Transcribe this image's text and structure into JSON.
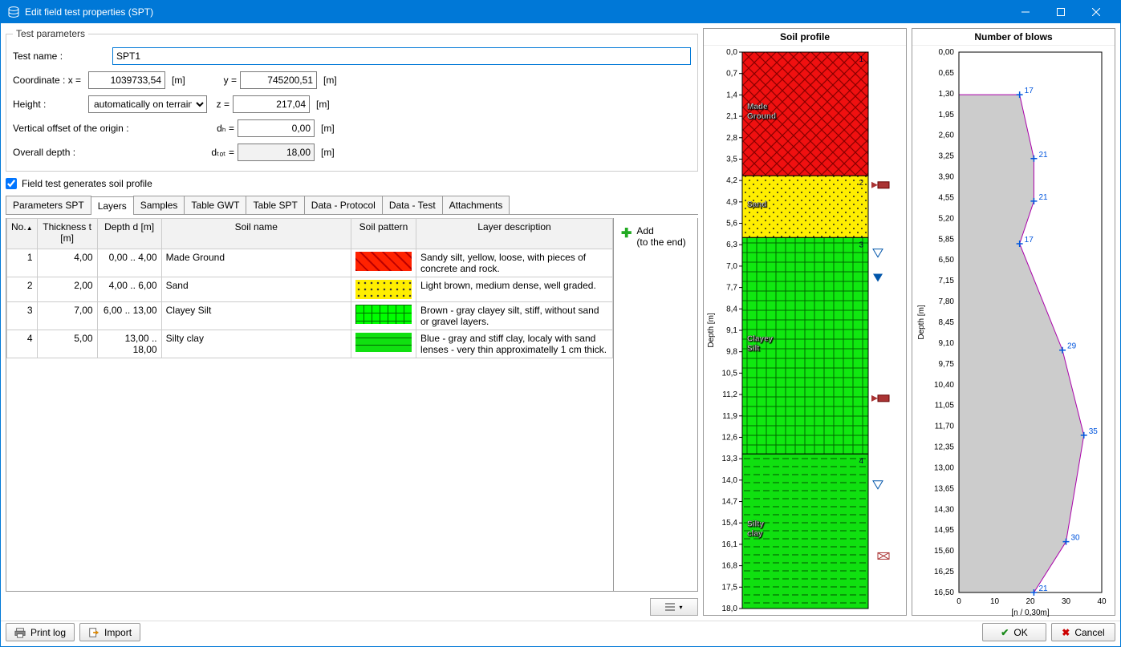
{
  "window": {
    "title": "Edit field test properties (SPT)"
  },
  "params": {
    "legend": "Test parameters",
    "testname_lbl": "Test name :",
    "testname": "SPT1",
    "coord_lbl": "Coordinate : x =",
    "x": "1039733,54",
    "x_unit": "[m]",
    "y_lbl": "y =",
    "y": "745200,51",
    "y_unit": "[m]",
    "height_lbl": "Height :",
    "height_mode": "automatically on terrain",
    "z_lbl": "z =",
    "z": "217,04",
    "z_unit": "[m]",
    "voff_lbl": "Vertical offset of the origin :",
    "dh_lbl": "dₕ =",
    "dh": "0,00",
    "dh_unit": "[m]",
    "depth_lbl": "Overall depth :",
    "dtot_lbl": "dₜₒₜ =",
    "dtot": "18,00",
    "dtot_unit": "[m]",
    "gen_chk": "Field test generates soil profile"
  },
  "tabs": [
    "Parameters SPT",
    "Layers",
    "Samples",
    "Table GWT",
    "Table SPT",
    "Data - Protocol",
    "Data - Test",
    "Attachments"
  ],
  "active_tab": 1,
  "table": {
    "headers": {
      "no": "No.",
      "thick": "Thickness\nt [m]",
      "depth": "Depth\nd [m]",
      "name": "Soil name",
      "patt": "Soil pattern",
      "desc": "Layer description"
    },
    "rows": [
      {
        "no": "1",
        "t": "4,00",
        "d": "0,00 .. 4,00",
        "name": "Made Ground",
        "patt": "red",
        "desc": "Sandy silt, yellow, loose, with pieces of concrete and rock."
      },
      {
        "no": "2",
        "t": "2,00",
        "d": "4,00 .. 6,00",
        "name": "Sand",
        "patt": "yellow",
        "desc": "Light brown, medium dense, well graded."
      },
      {
        "no": "3",
        "t": "7,00",
        "d": "6,00 .. 13,00",
        "name": "Clayey Silt",
        "patt": "green1",
        "desc": "Brown - gray clayey silt, stiff, without sand or gravel layers."
      },
      {
        "no": "4",
        "t": "5,00",
        "d": "13,00 .. 18,00",
        "name": "Silty clay",
        "patt": "green2",
        "desc": "Blue - gray and stiff clay, localy with sand lenses - very thin approximatelly 1 cm thick."
      }
    ],
    "add": "Add",
    "add2": "(to the end)"
  },
  "profile": {
    "title": "Soil profile",
    "ylabel": "Depth [m]",
    "ticks": [
      "0,0",
      "0,7",
      "1,4",
      "2,1",
      "2,8",
      "3,5",
      "4,2",
      "4,9",
      "5,6",
      "6,3",
      "7,0",
      "7,7",
      "8,4",
      "9,1",
      "9,8",
      "10,5",
      "11,2",
      "11,9",
      "12,6",
      "13,3",
      "14,0",
      "14,7",
      "15,4",
      "16,1",
      "16,8",
      "17,5",
      "18,0"
    ],
    "layers": [
      {
        "name": "Made Ground",
        "from": 0,
        "to": 4,
        "num": "1",
        "patt": "red"
      },
      {
        "name": "Sand",
        "from": 4,
        "to": 6,
        "num": "2",
        "patt": "yellow"
      },
      {
        "name": "Clayey Silt",
        "from": 6,
        "to": 13,
        "num": "3",
        "patt": "green1"
      },
      {
        "name": "Silty clay",
        "from": 13,
        "to": 18,
        "num": "4",
        "patt": "green2"
      }
    ]
  },
  "blows": {
    "title": "Number of blows",
    "ylabel": "Depth [m]",
    "xlabel": "[n / 0,30m]",
    "yticks": [
      "0,00",
      "0,65",
      "1,30",
      "1,95",
      "2,60",
      "3,25",
      "3,90",
      "4,55",
      "5,20",
      "5,85",
      "6,50",
      "7,15",
      "7,80",
      "8,45",
      "9,10",
      "9,75",
      "10,40",
      "11,05",
      "11,70",
      "12,35",
      "13,00",
      "13,65",
      "14,30",
      "14,95",
      "15,60",
      "16,25",
      "16,50"
    ],
    "xticks": [
      "0",
      "10",
      "20",
      "30",
      "40"
    ]
  },
  "chart_data": {
    "type": "line",
    "title": "Number of blows",
    "x": [
      17,
      21,
      21,
      17,
      29,
      35,
      30,
      21
    ],
    "y": [
      1.3,
      3.25,
      4.55,
      5.85,
      9.1,
      11.7,
      14.95,
      16.5
    ],
    "xlabel": "[n / 0,30m]",
    "ylabel": "Depth [m]",
    "xlim": [
      0,
      40
    ],
    "ylim": [
      0,
      16.5
    ],
    "y_inverted": true
  },
  "footer": {
    "print": "Print log",
    "import": "Import",
    "ok": "OK",
    "cancel": "Cancel"
  }
}
